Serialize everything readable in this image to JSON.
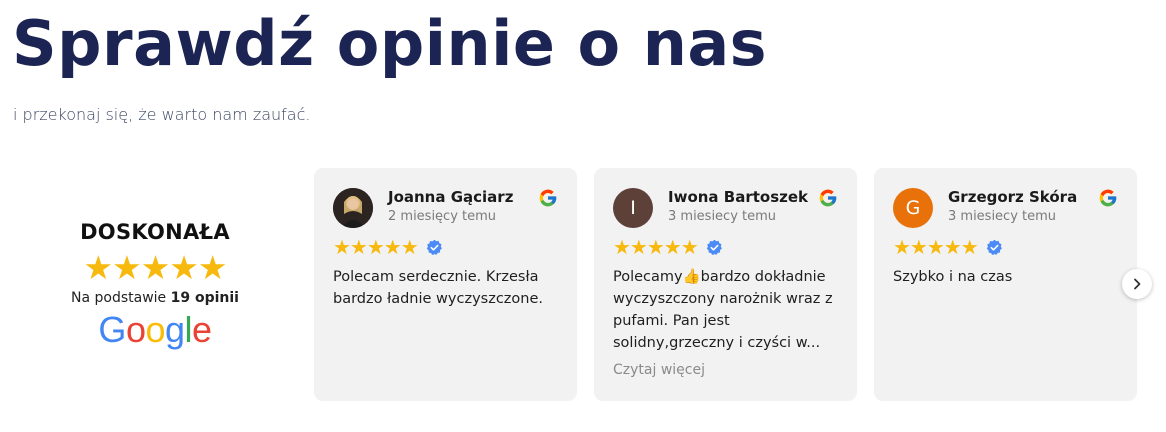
{
  "page": {
    "heading": "Sprawdź opinie o nas",
    "subheading": "i przekonaj się, że warto nam zaufać."
  },
  "summary": {
    "rating_label": "DOSKONAŁA",
    "stars": "★★★★★",
    "rating_value": 5,
    "basis_prefix": "Na podstawie",
    "basis_count": "19 opinii",
    "provider_letters": [
      "G",
      "o",
      "o",
      "g",
      "l",
      "e"
    ],
    "provider_colors": [
      "#4285f4",
      "#ea4335",
      "#fbbc05",
      "#4285f4",
      "#34a853",
      "#ea4335"
    ]
  },
  "reviews": [
    {
      "author": "Joanna Gąciarz",
      "date": "2 miesięcy temu",
      "stars": "★★★★★",
      "rating": 5,
      "text": "Polecam serdecznie. Krzesła bardzo ładnie wyczyszczone.",
      "avatar_icon": "photo-avatar-icon"
    },
    {
      "author": "Iwona Bartoszek",
      "date": "3 miesiecy temu",
      "stars": "★★★★★",
      "rating": 5,
      "text": "Polecamy👍bardzo dokładnie wyczyszczony narożnik wraz z pufami. Pan jest solidny,grzeczny i czyści w...",
      "read_more": "Czytaj więcej",
      "avatar_letter": "I",
      "avatar_color": "#5d4037"
    },
    {
      "author": "Grzegorz Skóra",
      "date": "3 miesiecy temu",
      "stars": "★★★★★",
      "rating": 5,
      "text": "Szybko i na czas",
      "avatar_letter": "G",
      "avatar_color": "#e8710a"
    }
  ],
  "icons": {
    "google": "google-g-icon",
    "verified": "verified-badge-icon",
    "next": "chevron-right-icon"
  },
  "colors": {
    "heading": "#1b2452",
    "star": "#f7b90d",
    "card_bg": "#f2f2f2",
    "verified": "#4c8bf5"
  }
}
